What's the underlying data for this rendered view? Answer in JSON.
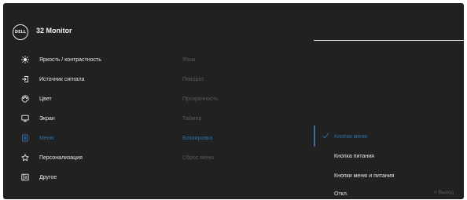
{
  "header": {
    "logo_text": "DELL",
    "title": "32 Monitor"
  },
  "main_menu": [
    {
      "label": "Яркость / контрастность",
      "icon": "brightness-icon",
      "state": "normal"
    },
    {
      "label": "Источник сигнала",
      "icon": "input-source-icon",
      "state": "normal"
    },
    {
      "label": "Цвет",
      "icon": "palette-icon",
      "state": "normal"
    },
    {
      "label": "Экран",
      "icon": "display-icon",
      "state": "normal"
    },
    {
      "label": "Меню",
      "icon": "menu-icon",
      "state": "active"
    },
    {
      "label": "Персонализация",
      "icon": "star-icon",
      "state": "normal"
    },
    {
      "label": "Другое",
      "icon": "other-icon",
      "state": "normal"
    }
  ],
  "sub_menu": [
    {
      "label": "Язык",
      "state": "dim"
    },
    {
      "label": "Поворот",
      "state": "dim"
    },
    {
      "label": "Прозрачность",
      "state": "dim"
    },
    {
      "label": "Таймер",
      "state": "dim"
    },
    {
      "label": "Блокировка",
      "state": "active"
    },
    {
      "label": "Сброс меню",
      "state": "dim"
    }
  ],
  "options": [
    {
      "label": "Кнопки меню",
      "selected": true
    },
    {
      "label": "Кнопка питания",
      "selected": false
    },
    {
      "label": "Кнопки меню и питания",
      "selected": false
    },
    {
      "label": "Откл.",
      "selected": false
    }
  ],
  "footer": {
    "exit_label": "Выход"
  },
  "colors": {
    "background": "#212121",
    "accent": "#2f6fa5",
    "text": "#e8e8e8",
    "dim": "#5a5a5a"
  }
}
